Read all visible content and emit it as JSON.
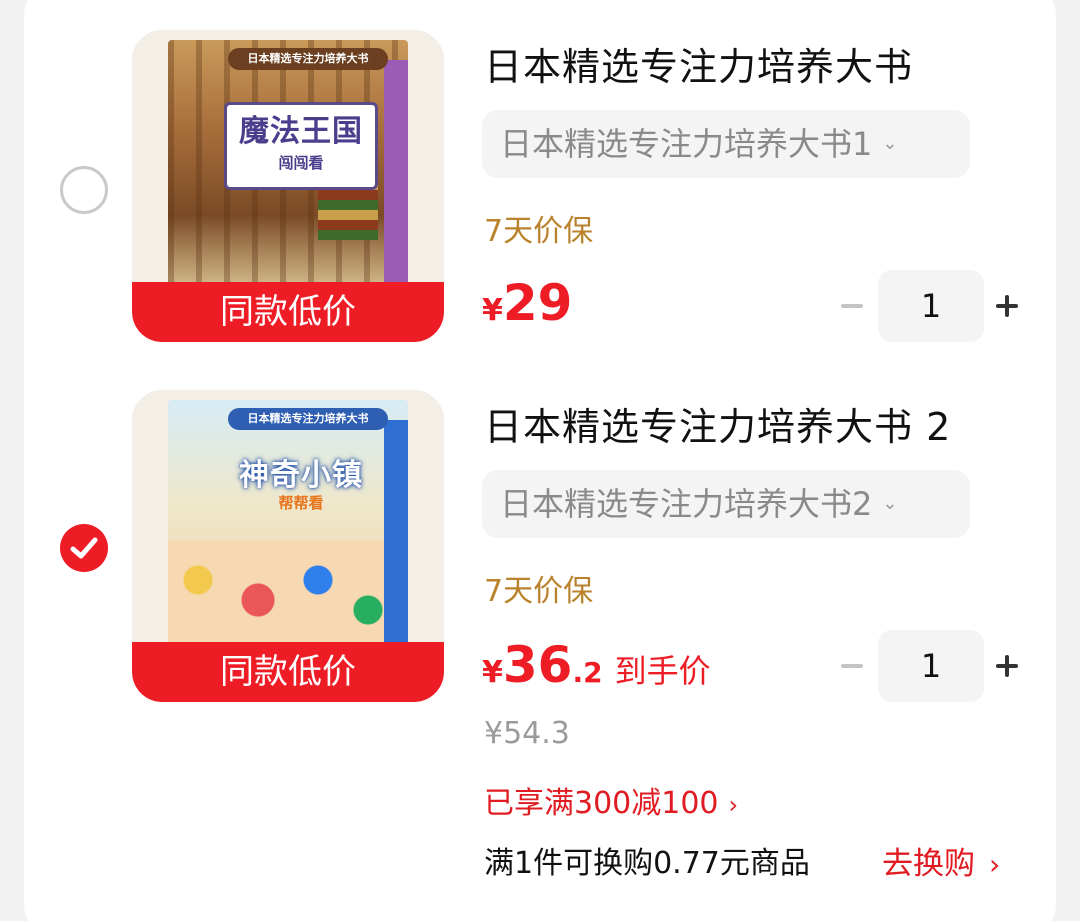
{
  "items": [
    {
      "selected": false,
      "title": "日本精选专注力培养大书",
      "spec": "日本精选专注力培养大书1",
      "guarantee": "7天价保",
      "price_symbol": "¥",
      "price_int": "29",
      "price_dec": "",
      "price_note": "",
      "quantity": "1",
      "tag": "同款低价",
      "cover": {
        "badge": "日本精选专注力培养大书",
        "title": "魔法王国",
        "subtitle": "闯闯看"
      }
    },
    {
      "selected": true,
      "title": "日本精选专注力培养大书 2",
      "spec": "日本精选专注力培养大书2",
      "guarantee": "7天价保",
      "price_symbol": "¥",
      "price_int": "36",
      "price_dec": ".2",
      "price_note": "到手价",
      "quantity": "1",
      "tag": "同款低价",
      "original_price": "¥54.3",
      "promo": "已享满300减100",
      "swap_text": "满1件可换购0.77元商品",
      "swap_link": "去换购",
      "cover": {
        "badge": "日本精选专注力培养大书",
        "title": "神奇小镇",
        "subtitle": "帮帮看"
      }
    }
  ],
  "colors": {
    "accent": "#ee1c25",
    "guarantee": "#b9822b"
  }
}
